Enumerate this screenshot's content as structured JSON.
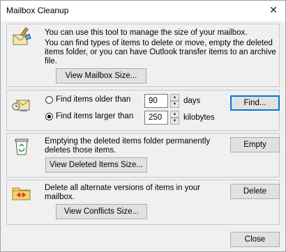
{
  "window": {
    "title": "Mailbox Cleanup",
    "close_glyph": "✕"
  },
  "section_manage": {
    "icon": "mailbox-cleanup-icon",
    "line1": "You can use this tool to manage the size of your mailbox.",
    "line2": "You can find types of items to delete or move, empty the deleted",
    "line3": "items folder, or you can have Outlook transfer items to an archive",
    "line4": "file.",
    "view_size_button": "View Mailbox Size..."
  },
  "section_find": {
    "icon": "find-items-icon",
    "older_label": "Find items older than",
    "older_value": "90",
    "older_unit": "days",
    "larger_label": "Find items larger than",
    "larger_value": "250",
    "larger_unit": "kilobytes",
    "selected_option": "larger",
    "find_button": "Find..."
  },
  "section_deleted": {
    "icon": "recycle-bin-icon",
    "line1": "Emptying the deleted items folder permanently",
    "line2": "deletes those items.",
    "empty_button": "Empty",
    "view_button": "View Deleted Items Size..."
  },
  "section_conflicts": {
    "icon": "conflicts-folder-icon",
    "line1": "Delete all alternate versions of items in your",
    "line2": "mailbox.",
    "delete_button": "Delete",
    "view_button": "View Conflicts Size..."
  },
  "footer": {
    "close_button": "Close"
  },
  "colors": {
    "accent": "#0078d7",
    "background": "#f0f0f0",
    "button": "#e1e1e1"
  }
}
